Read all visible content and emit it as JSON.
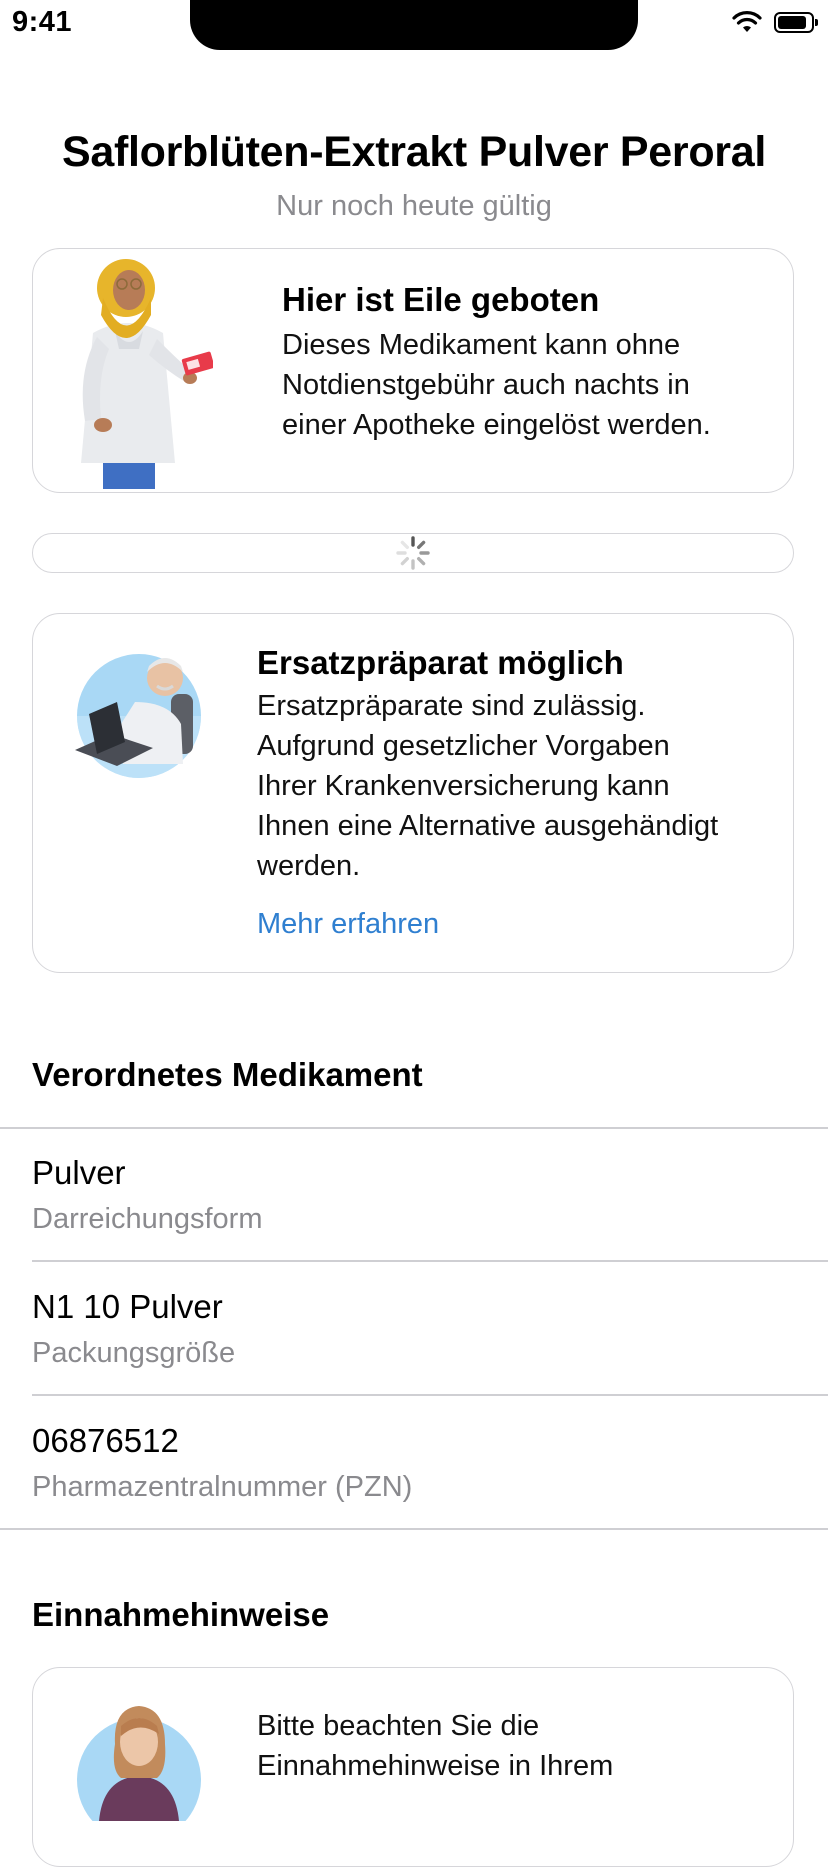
{
  "status": {
    "time": "9:41"
  },
  "header": {
    "title": "Saflorblüten-Extrakt Pulver Peroral",
    "subtitle": "Nur noch heute gültig"
  },
  "urgent_card": {
    "heading": "Hier ist Eile geboten",
    "body_lines": [
      "Dieses Medikament kann ohne",
      "Notdienstgebühr auch nachts in",
      "einer Apotheke eingelöst werden."
    ]
  },
  "substitute_card": {
    "heading": "Ersatzpräparat möglich",
    "body_lines": [
      "Ersatzpräparate sind zulässig.",
      "Aufgrund gesetzlicher Vorgaben",
      "Ihrer Krankenversicherung kann",
      "Ihnen eine Alternative ausgehändigt",
      "werden."
    ],
    "link": "Mehr erfahren"
  },
  "prescribed_section": {
    "title": "Verordnetes Medikament",
    "rows": [
      {
        "value": "Pulver",
        "label": "Darreichungsform"
      },
      {
        "value": "N1 10 Pulver",
        "label": "Packungsgröße"
      },
      {
        "value": "06876512",
        "label": "Pharmazentralnummer (PZN)"
      }
    ]
  },
  "intake_section": {
    "title": "Einnahmehinweise",
    "body_lines": [
      "Bitte beachten Sie die",
      "Einnahmehinweise in Ihrem"
    ]
  },
  "icons": {
    "wifi": "wifi-icon",
    "battery": "battery-icon",
    "spinner": "loading-spinner-icon",
    "pharmacist": "pharmacist-illustration",
    "doctor": "doctor-illustration",
    "woman": "woman-illustration"
  },
  "colors": {
    "link": "#2f7fd0",
    "secondary_text": "#8a8a8e",
    "border": "#d6d6da"
  }
}
